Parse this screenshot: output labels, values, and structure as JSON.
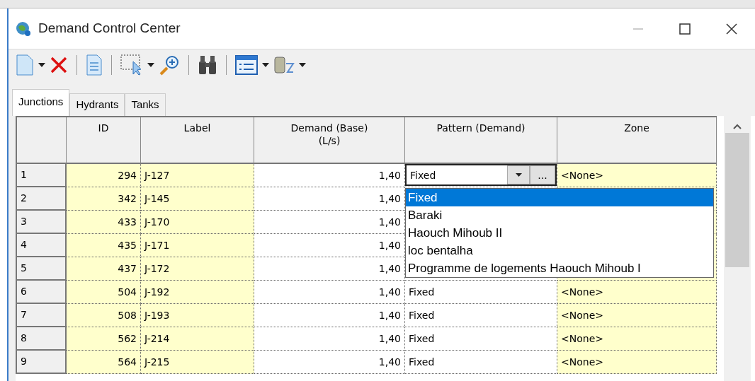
{
  "window": {
    "title": "Demand Control Center"
  },
  "toolbar": [
    {
      "kind": "button",
      "dropdown": true
    },
    {
      "kind": "button",
      "dropdown": false
    },
    {
      "kind": "separator"
    },
    {
      "kind": "button",
      "dropdown": false
    },
    {
      "kind": "separator"
    },
    {
      "kind": "button",
      "dropdown": true
    },
    {
      "kind": "button",
      "dropdown": false
    },
    {
      "kind": "separator"
    },
    {
      "kind": "button",
      "dropdown": false
    },
    {
      "kind": "separator"
    },
    {
      "kind": "button",
      "dropdown": true
    },
    {
      "kind": "button",
      "dropdown": true
    }
  ],
  "tabs": [
    {
      "label": "Junctions",
      "selected": true
    },
    {
      "label": "Hydrants",
      "selected": false
    },
    {
      "label": "Tanks",
      "selected": false
    }
  ],
  "table": {
    "columns": [
      "ID",
      "Label",
      "Demand (Base)\n(L/s)",
      "Pattern (Demand)",
      "Zone"
    ],
    "rows": [
      {
        "number": "1",
        "id": "294",
        "label": "J-127",
        "demand": "1,40",
        "pattern": "Fixed",
        "zone": "<None>",
        "editing": true
      },
      {
        "number": "2",
        "id": "342",
        "label": "J-145",
        "demand": "1,40",
        "editing": false
      },
      {
        "number": "3",
        "id": "433",
        "label": "J-170",
        "demand": "1,40",
        "editing": false
      },
      {
        "number": "4",
        "id": "435",
        "label": "J-171",
        "demand": "1,40",
        "editing": false
      },
      {
        "number": "5",
        "id": "437",
        "label": "J-172",
        "demand": "1,40",
        "editing": false
      },
      {
        "number": "6",
        "id": "504",
        "label": "J-192",
        "demand": "1,40",
        "pattern": "Fixed",
        "zone": "<None>",
        "editing": false
      },
      {
        "number": "7",
        "id": "508",
        "label": "J-193",
        "demand": "1,40",
        "pattern": "Fixed",
        "zone": "<None>",
        "editing": false
      },
      {
        "number": "8",
        "id": "562",
        "label": "J-214",
        "demand": "1,40",
        "pattern": "Fixed",
        "zone": "<None>",
        "editing": false
      },
      {
        "number": "9",
        "id": "564",
        "label": "J-215",
        "demand": "1,40",
        "pattern": "Fixed",
        "zone": "<None>",
        "editing": false
      }
    ],
    "editor_button": "...",
    "dropdown": [
      {
        "label": "Fixed",
        "selected": true
      },
      {
        "label": "Baraki",
        "selected": false
      },
      {
        "label": "Haouch Mihoub II",
        "selected": false
      },
      {
        "label": "loc bentalha",
        "selected": false
      },
      {
        "label": "Programme de logements  Haouch Mihoub I",
        "selected": false
      }
    ]
  }
}
